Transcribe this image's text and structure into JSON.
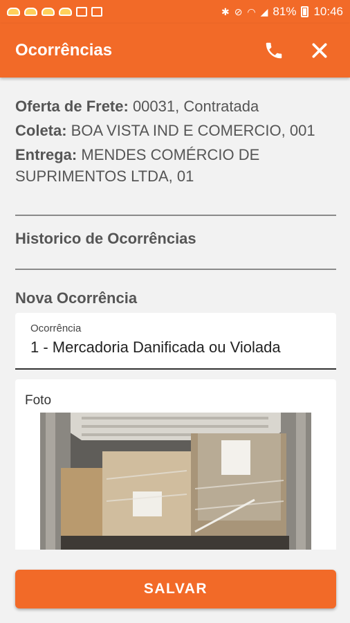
{
  "status_bar": {
    "battery": "81%",
    "time": "10:46"
  },
  "app_bar": {
    "title": "Ocorrências",
    "phone_icon": "phone-icon",
    "close_icon": "close-icon"
  },
  "freight_info": {
    "offer_label": "Oferta de Frete:",
    "offer_value": " 00031, Contratada",
    "pickup_label": "Coleta:",
    "pickup_value": " BOA VISTA IND E COMERCIO, 001",
    "delivery_label": "Entrega:",
    "delivery_value": " MENDES COMÉRCIO DE SUPRIMENTOS LTDA, 01"
  },
  "history": {
    "title": "Historico de Ocorrências"
  },
  "new_occurrence": {
    "title": "Nova Ocorrência",
    "field_label": "Ocorrência",
    "field_value": "1 - Mercadoria Danificada ou Violada",
    "photo_label": "Foto"
  },
  "actions": {
    "save_label": "SALVAR"
  },
  "colors": {
    "accent": "#f26a28",
    "background": "#f2f2f2"
  }
}
